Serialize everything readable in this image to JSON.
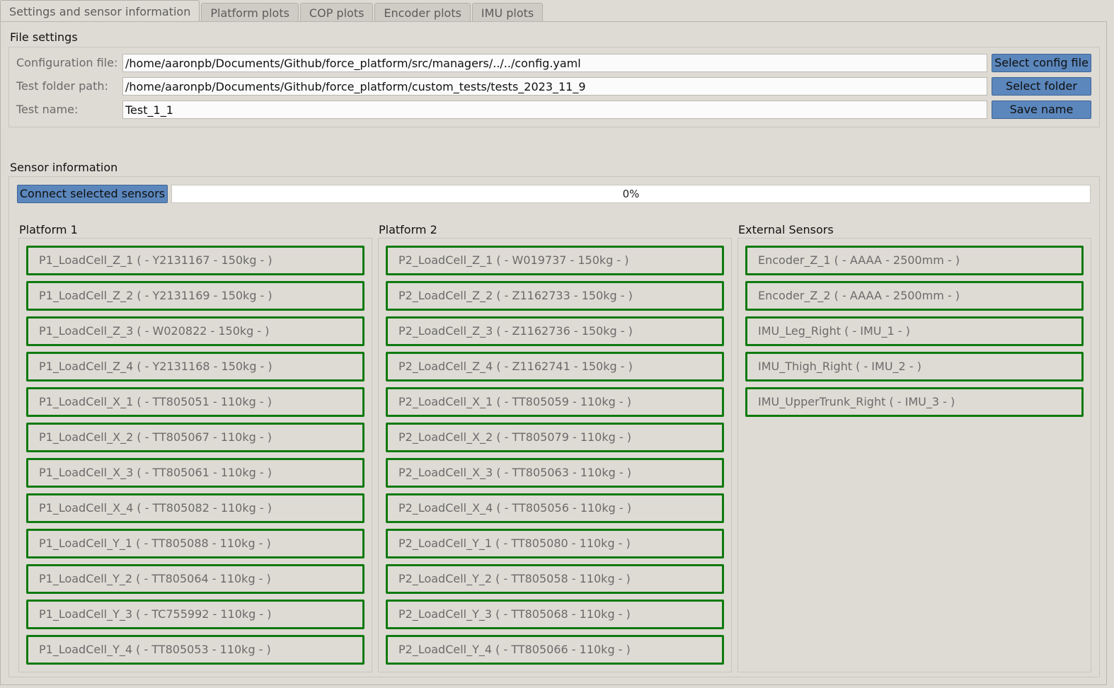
{
  "tabs": [
    {
      "label": "Settings and sensor information",
      "active": true
    },
    {
      "label": "Platform plots",
      "active": false
    },
    {
      "label": "COP plots",
      "active": false
    },
    {
      "label": "Encoder plots",
      "active": false
    },
    {
      "label": "IMU plots",
      "active": false
    }
  ],
  "file_settings": {
    "title": "File settings",
    "config_label": "Configuration file:",
    "config_value": "/home/aaronpb/Documents/Github/force_platform/src/managers/../../config.yaml",
    "config_button": "Select config file",
    "folder_label": "Test folder path:",
    "folder_value": "/home/aaronpb/Documents/Github/force_platform/custom_tests/tests_2023_11_9",
    "folder_button": "Select folder",
    "name_label": "Test name:",
    "name_value": "Test_1_1",
    "name_button": "Save name"
  },
  "sensor_info": {
    "title": "Sensor information",
    "connect_button": "Connect selected sensors",
    "progress_text": "0%",
    "progress_value": 0
  },
  "columns": [
    {
      "title": "Platform 1",
      "sensors": [
        "P1_LoadCell_Z_1 ( - Y2131167 - 150kg - )",
        "P1_LoadCell_Z_2 ( - Y2131169 - 150kg - )",
        "P1_LoadCell_Z_3 ( - W020822 - 150kg - )",
        "P1_LoadCell_Z_4 ( - Y2131168 - 150kg - )",
        "P1_LoadCell_X_1 ( - TT805051 - 110kg - )",
        "P1_LoadCell_X_2 ( - TT805067 - 110kg - )",
        "P1_LoadCell_X_3 ( - TT805061 - 110kg - )",
        "P1_LoadCell_X_4 ( - TT805082 - 110kg - )",
        "P1_LoadCell_Y_1 ( - TT805088 - 110kg - )",
        "P1_LoadCell_Y_2 ( - TT805064 - 110kg - )",
        "P1_LoadCell_Y_3 ( - TC755992 - 110kg - )",
        "P1_LoadCell_Y_4 ( - TT805053 - 110kg - )"
      ]
    },
    {
      "title": "Platform 2",
      "sensors": [
        "P2_LoadCell_Z_1 ( - W019737 - 150kg - )",
        "P2_LoadCell_Z_2 ( - Z1162733 - 150kg - )",
        "P2_LoadCell_Z_3 ( - Z1162736 - 150kg - )",
        "P2_LoadCell_Z_4 ( - Z1162741 - 150kg - )",
        "P2_LoadCell_X_1 ( - TT805059 - 110kg - )",
        "P2_LoadCell_X_2 ( - TT805079 - 110kg - )",
        "P2_LoadCell_X_3 ( - TT805063 - 110kg - )",
        "P2_LoadCell_X_4 ( - TT805056 - 110kg - )",
        "P2_LoadCell_Y_1 ( - TT805080 - 110kg - )",
        "P2_LoadCell_Y_2 ( - TT805058 - 110kg - )",
        "P2_LoadCell_Y_3 ( - TT805068 - 110kg - )",
        "P2_LoadCell_Y_4 ( - TT805066 - 110kg - )"
      ]
    },
    {
      "title": "External Sensors",
      "sensors": [
        "Encoder_Z_1 ( - AAAA - 2500mm - )",
        "Encoder_Z_2 ( - AAAA - 2500mm - )",
        "IMU_Leg_Right ( - IMU_1 - )",
        "IMU_Thigh_Right ( - IMU_2 - )",
        "IMU_UpperTrunk_Right ( - IMU_3 - )"
      ]
    }
  ],
  "colors": {
    "sensor_border": "#0f7a0f",
    "button_bg": "#5b87bd",
    "window_bg": "#dedbd4"
  }
}
